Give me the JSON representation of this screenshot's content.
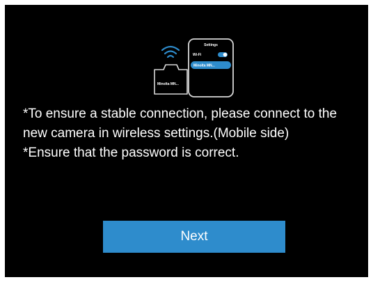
{
  "illustration": {
    "phone_title": "Settings",
    "wifi_label": "Wi-Fi",
    "network_name": "Minolta MN...",
    "camera_label": "Minolta MN...",
    "wifi_icon": "wifi-signal-icon",
    "toggle_state": "on",
    "accent_color": "#2e8ccc"
  },
  "message": {
    "lines": [
      "*To ensure a stable connection, please connect to the new camera in wireless settings.(Mobile side)",
      "*Ensure that the password is correct."
    ]
  },
  "actions": {
    "next_label": "Next"
  }
}
